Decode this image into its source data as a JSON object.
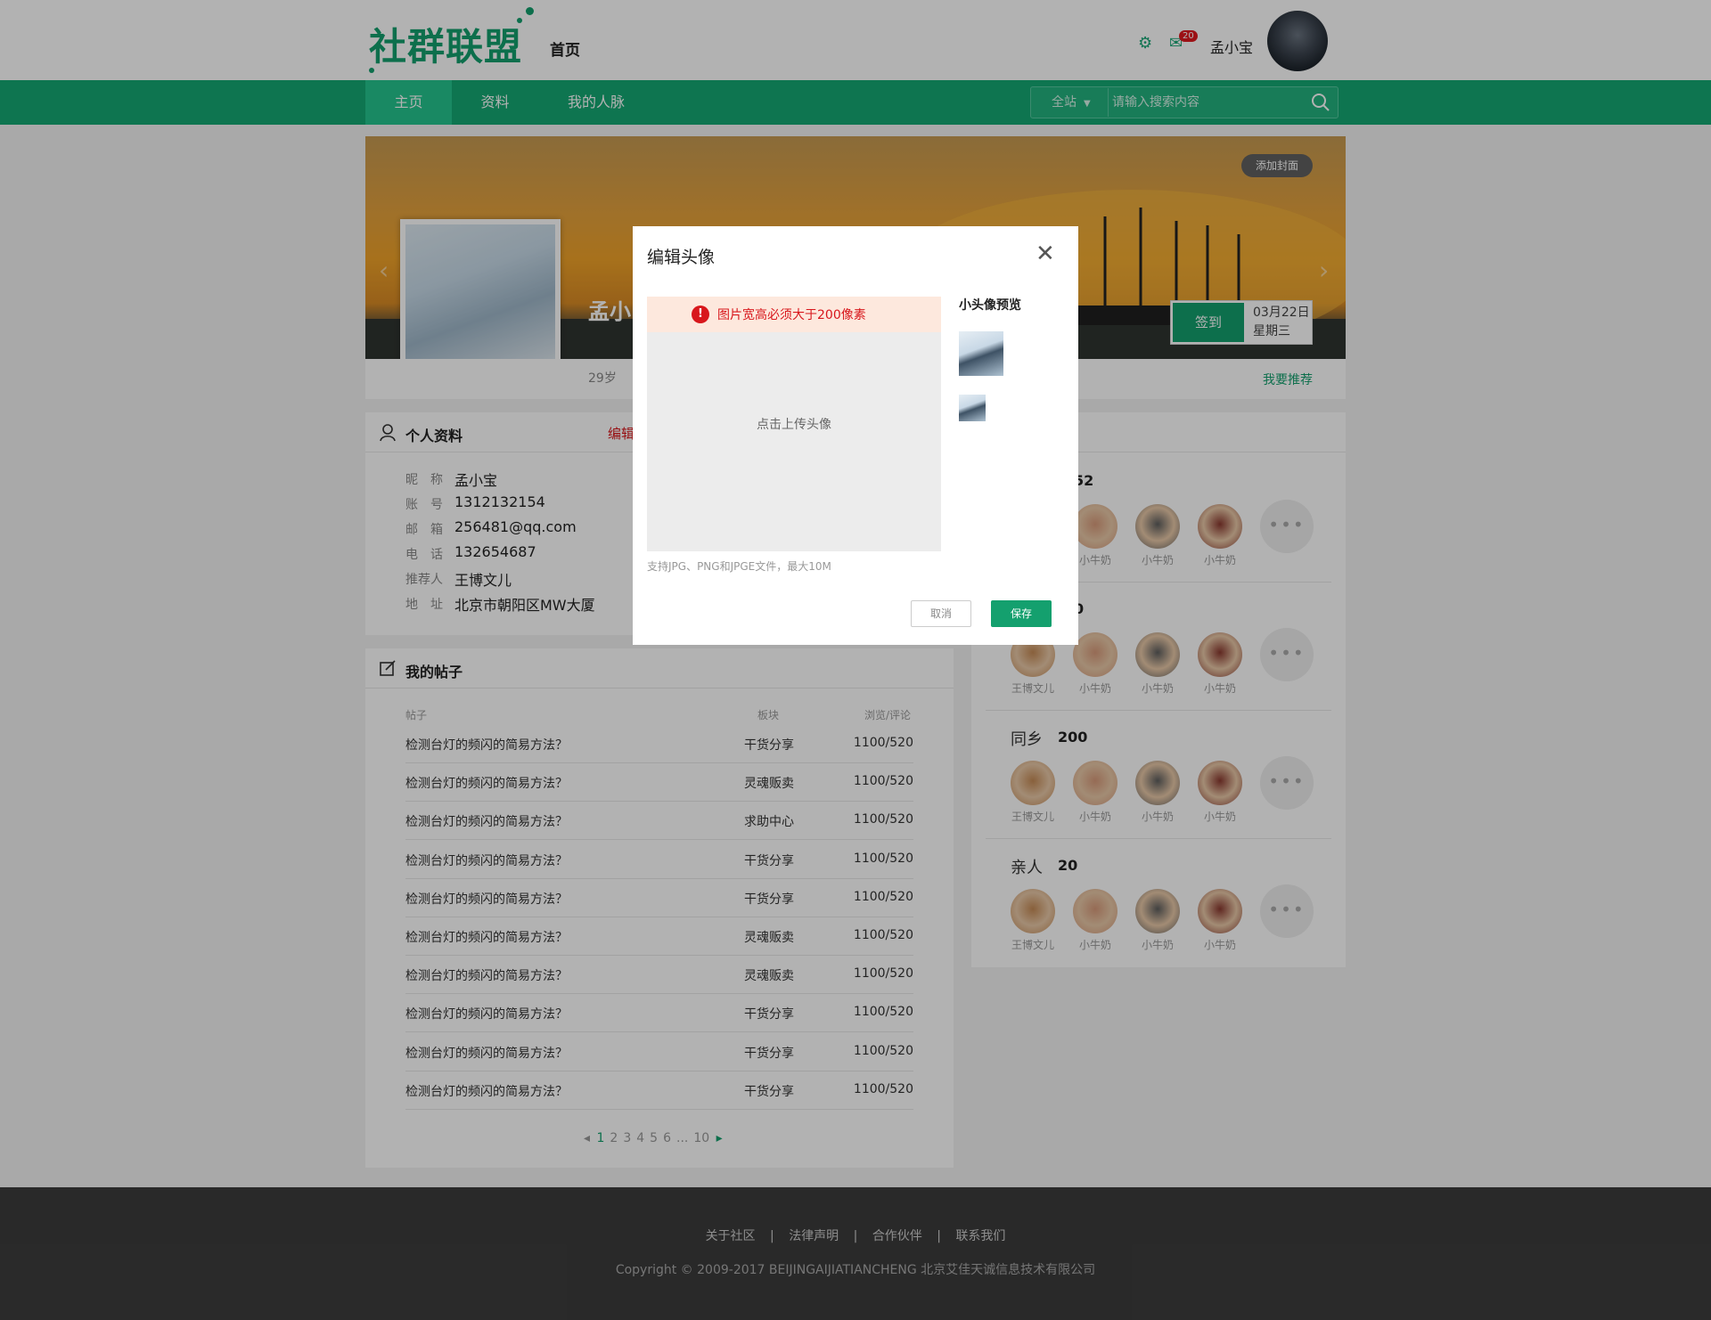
{
  "header": {
    "logo": "社群联盟",
    "home_link": "首页",
    "mail_badge": "20",
    "username": "孟小宝"
  },
  "nav": {
    "items": [
      {
        "label": "主页",
        "active": true
      },
      {
        "label": "资料",
        "active": false
      },
      {
        "label": "我的人脉",
        "active": false
      }
    ],
    "search_scope": "全站",
    "search_placeholder": "请输入搜索内容"
  },
  "banner": {
    "add_cover": "添加封面",
    "name_partial": "孟小",
    "signin_label": "签到",
    "date": "03月22日",
    "weekday": "星期三",
    "age": "29岁",
    "recommend": "我要推荐"
  },
  "profile": {
    "title": "个人资料",
    "edit_label": "编辑",
    "fields": [
      {
        "label": "昵　称",
        "value": "孟小宝"
      },
      {
        "label": "账　号",
        "value": "1312132154"
      },
      {
        "label": "邮　箱",
        "value": "256481@qq.com"
      },
      {
        "label": "电　话",
        "value": "132654687"
      },
      {
        "label": "推荐人",
        "value": "王博文儿"
      },
      {
        "label": "地　址",
        "value": "北京市朝阳区MW大厦"
      }
    ]
  },
  "posts": {
    "title": "我的帖子",
    "columns": [
      "帖子",
      "板块",
      "浏览/评论"
    ],
    "rows": [
      {
        "title": "检测台灯的频闪的简易方法？",
        "board": "干货分享",
        "stats": "1100/520"
      },
      {
        "title": "检测台灯的频闪的简易方法？",
        "board": "灵魂贩卖",
        "stats": "1100/520"
      },
      {
        "title": "检测台灯的频闪的简易方法？",
        "board": "求助中心",
        "stats": "1100/520"
      },
      {
        "title": "检测台灯的频闪的简易方法？",
        "board": "干货分享",
        "stats": "1100/520"
      },
      {
        "title": "检测台灯的频闪的简易方法？",
        "board": "干货分享",
        "stats": "1100/520"
      },
      {
        "title": "检测台灯的频闪的简易方法？",
        "board": "灵魂贩卖",
        "stats": "1100/520"
      },
      {
        "title": "检测台灯的频闪的简易方法？",
        "board": "灵魂贩卖",
        "stats": "1100/520"
      },
      {
        "title": "检测台灯的频闪的简易方法？",
        "board": "干货分享",
        "stats": "1100/520"
      },
      {
        "title": "检测台灯的频闪的简易方法？",
        "board": "干货分享",
        "stats": "1100/520"
      },
      {
        "title": "检测台灯的频闪的简易方法？",
        "board": "干货分享",
        "stats": "1100/520"
      }
    ],
    "pager": {
      "pages": [
        "1",
        "2",
        "3",
        "4",
        "5",
        "6",
        "...",
        "10"
      ],
      "current": "1"
    }
  },
  "network": {
    "groups": [
      {
        "title": "",
        "count": "52",
        "members": [
          "",
          "小牛奶",
          "小牛奶",
          "小牛奶"
        ]
      },
      {
        "title": "",
        "count": "0",
        "members": [
          "王博文儿",
          "小牛奶",
          "小牛奶",
          "小牛奶"
        ]
      },
      {
        "title": "同乡",
        "count": "200",
        "members": [
          "王博文儿",
          "小牛奶",
          "小牛奶",
          "小牛奶"
        ]
      },
      {
        "title": "亲人",
        "count": "20",
        "members": [
          "王博文儿",
          "小牛奶",
          "小牛奶",
          "小牛奶"
        ]
      }
    ]
  },
  "footer": {
    "links": [
      "关于社区",
      "法律声明",
      "合作伙伴",
      "联系我们"
    ],
    "separator": "|",
    "copyright": "Copyright © 2009-2017 BEIJINGAIJIATIANCHENG 北京艾佳天诚信息技术有限公司"
  },
  "modal": {
    "title": "编辑头像",
    "warning": "图片宽高必须大于200像素",
    "upload_prompt": "点击上传头像",
    "hint": "支持JPG、PNG和JPGE文件，最大10M",
    "preview_title": "小头像预览",
    "cancel": "取消",
    "save": "保存"
  },
  "colors": {
    "brand": "#14a06e",
    "warning": "#d8171c",
    "footer": "#3c3c3c"
  }
}
